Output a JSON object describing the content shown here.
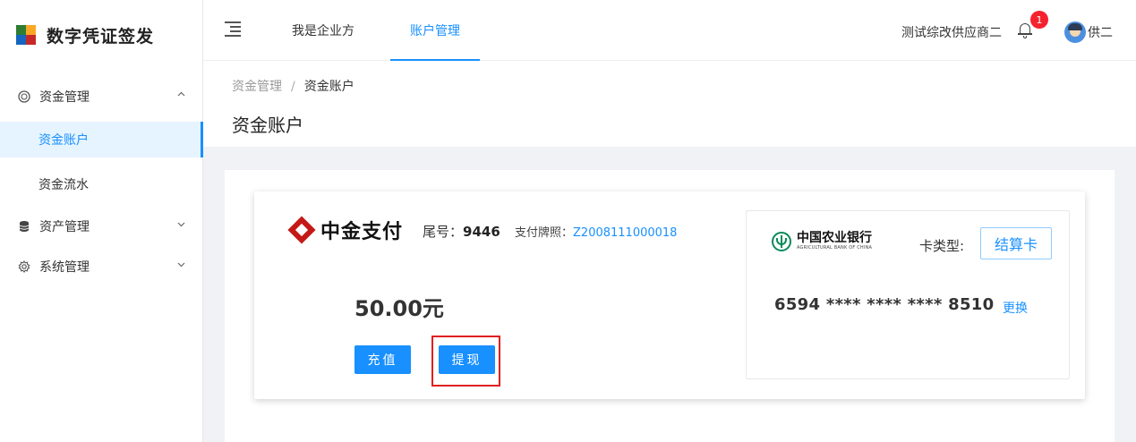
{
  "app": {
    "title": "数字凭证签发"
  },
  "sidebar": {
    "groups": [
      {
        "label": "资金管理",
        "expanded": true,
        "items": [
          {
            "label": "资金账户",
            "active": true
          },
          {
            "label": "资金流水",
            "active": false
          }
        ]
      },
      {
        "label": "资产管理",
        "expanded": false
      },
      {
        "label": "系统管理",
        "expanded": false
      }
    ]
  },
  "header": {
    "tabs": [
      {
        "label": "我是企业方",
        "active": false
      },
      {
        "label": "账户管理",
        "active": true
      }
    ],
    "org_name": "测试综改供应商二",
    "notification_count": "1",
    "user_name": "供二"
  },
  "breadcrumb": {
    "parent": "资金管理",
    "separator": "/",
    "current": "资金账户"
  },
  "page": {
    "title": "资金账户"
  },
  "account": {
    "provider_name": "中金支付",
    "tail_label": "尾号：",
    "tail_number": "9446",
    "license_label": "支付牌照：",
    "license_number": "Z2008111000018",
    "balance": "50.00元",
    "recharge_label": "充值",
    "withdraw_label": "提现"
  },
  "bank_card": {
    "bank_name_cn": "中国农业银行",
    "bank_name_en": "AGRICULTURAL BANK OF CHINA",
    "card_type_label": "卡类型:",
    "card_type": "结算卡",
    "card_number": "6594 **** **** **** 8510",
    "change_label": "更换"
  },
  "colors": {
    "primary": "#1890ff",
    "highlight": "#e02020",
    "brand_red": "#c41a16",
    "bank_green": "#0a8a5a"
  }
}
